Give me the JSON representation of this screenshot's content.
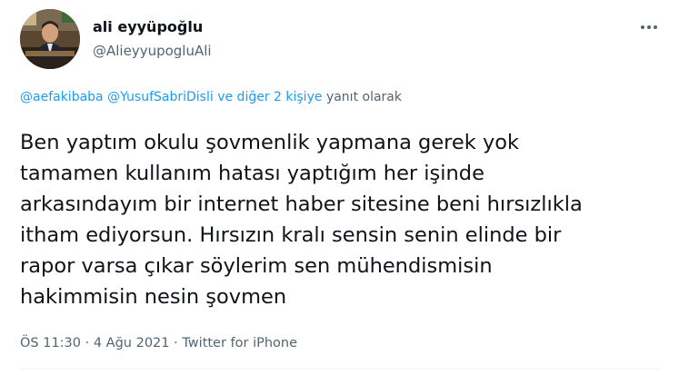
{
  "author": {
    "display_name": "ali eyyüpoğlu",
    "handle": "@AlieyyupogluAli"
  },
  "menu_icon": "more-horizontal-icon",
  "reply_context": {
    "mention_1": "@aefakibaba",
    "mention_2": "@YusufSabriDisli",
    "others": "ve diğer 2 kişiye",
    "suffix": "yanıt olarak"
  },
  "tweet": {
    "lines": [
      "Ben yaptım okulu şovmenlik yapmana gerek yok",
      "tamamen kullanım hatası yaptığım her işinde",
      "arkasındayım bir internet haber sitesine beni hırsızlıkla",
      "itham ediyorsun. Hırsızın kralı sensin senin elinde bir",
      "rapor varsa çıkar söylerim sen mühendismisin",
      "hakimmisin nesin şovmen"
    ]
  },
  "meta": {
    "time": "ÖS 11:30",
    "date": "4 Ağu 2021",
    "source": "Twitter for iPhone",
    "separator": "·"
  },
  "colors": {
    "text": "#0f1419",
    "secondary": "#536471",
    "link": "#1d9bf0"
  }
}
